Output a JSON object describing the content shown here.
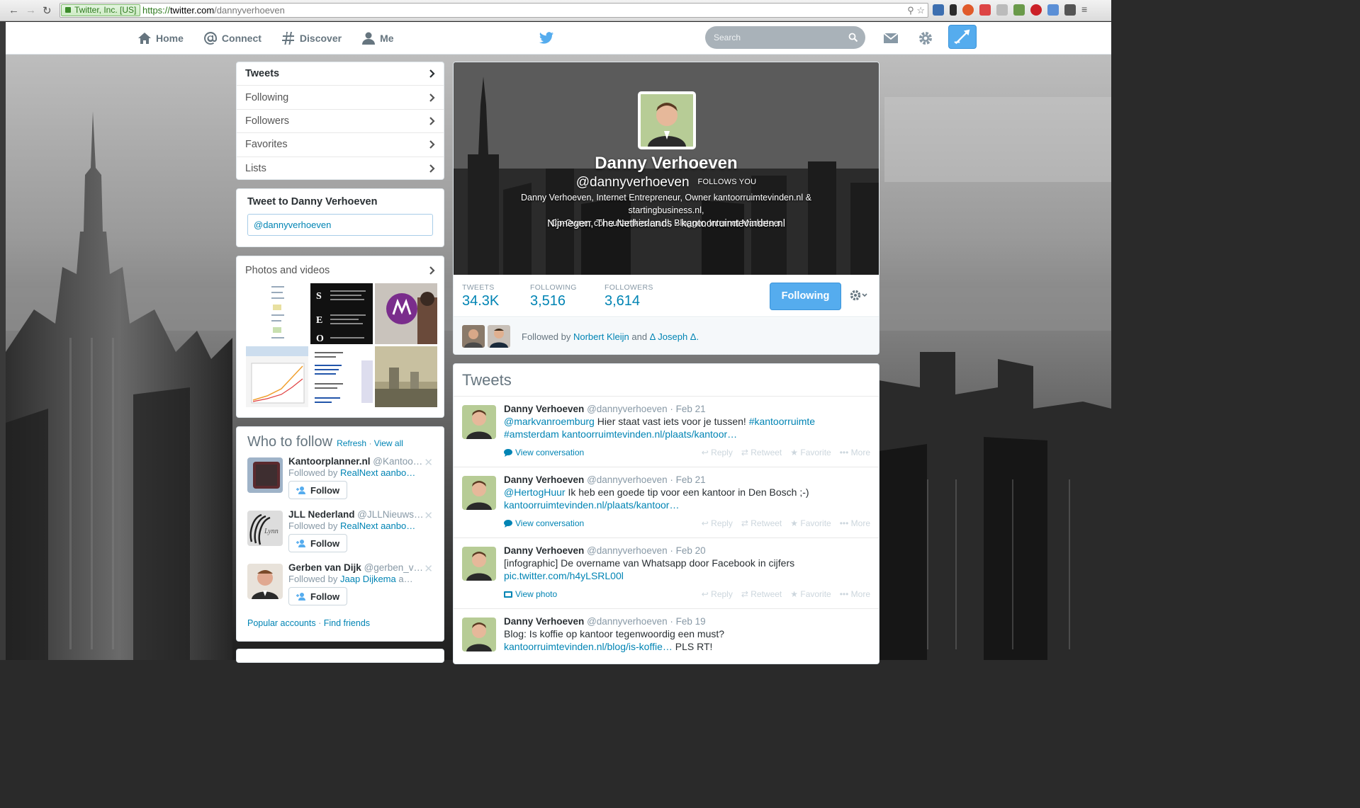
{
  "browser": {
    "ev_cert": "Twitter, Inc. [US]",
    "url_scheme": "https://",
    "url_host": "twitter.com",
    "url_path": "/dannyverhoeven"
  },
  "topbar": {
    "nav": [
      {
        "label": "Home",
        "icon": "home-icon"
      },
      {
        "label": "Connect",
        "icon": "at-icon"
      },
      {
        "label": "Discover",
        "icon": "hash-icon"
      },
      {
        "label": "Me",
        "icon": "person-icon"
      }
    ],
    "search_placeholder": "Search"
  },
  "sidebar_nav": [
    {
      "label": "Tweets"
    },
    {
      "label": "Following"
    },
    {
      "label": "Followers"
    },
    {
      "label": "Favorites"
    },
    {
      "label": "Lists"
    }
  ],
  "tweet_to": {
    "title": "Tweet to Danny Verhoeven",
    "value": "@dannyverhoeven"
  },
  "photos": {
    "title": "Photos and videos"
  },
  "who_to_follow": {
    "title": "Who to follow",
    "refresh": "Refresh",
    "separator": "·",
    "view_all": "View all",
    "follow_label": "Follow",
    "suggestions": [
      {
        "name": "Kantoorplanner.nl",
        "handle": "@Kantoo…",
        "followed_by_prefix": "Followed by ",
        "followed_by_link": "RealNext aanbo…"
      },
      {
        "name": "JLL Nederland",
        "handle": "@JLLNieuws…",
        "followed_by_prefix": "Followed by ",
        "followed_by_link": "RealNext aanbo…"
      },
      {
        "name": "Gerben van Dijk",
        "handle": "@gerben_v…",
        "followed_by_prefix": "Followed by ",
        "followed_by_link": "Jaap Dijkema",
        "followed_by_suffix": " a…"
      }
    ],
    "popular": "Popular accounts",
    "find_friends": "Find friends"
  },
  "profile": {
    "name": "Danny Verhoeven",
    "handle": "@dannyverhoeven",
    "follows_you": "FOLLOWS YOU",
    "bio_line1": "Danny Verhoeven, Internet Entrepreneur, Owner kantoorruimtevinden.nl & startingbusiness.nl,",
    "bio_line2": "Co-Owner consultantkiezen.nl, Blogger, Internet Marketeer",
    "location": "Nijmegen, The Netherlands",
    "loc_sep": "·",
    "website": "kantoorruimtevinden.nl"
  },
  "stats": {
    "tweets_label": "TWEETS",
    "tweets": "34.3K",
    "following_label": "FOLLOWING",
    "following": "3,516",
    "followers_label": "FOLLOWERS",
    "followers": "3,614"
  },
  "following_button": "Following",
  "followed_by": {
    "prefix": "Followed by ",
    "person1": "Norbert Kleijn",
    "and": " and ",
    "person2": "Δ Joseph Δ.",
    "suffix": ""
  },
  "stream": {
    "title": "Tweets",
    "actions": {
      "reply": "Reply",
      "retweet": "Retweet",
      "favorite": "Favorite",
      "more": "More"
    },
    "tweets": [
      {
        "name": "Danny Verhoeven",
        "handle": "@dannyverhoeven",
        "date": " · Feb 21",
        "mention": "@markvanroemburg",
        "text": " Hier staat vast iets voor je tussen! ",
        "hashtag1": "#kantoorruimte",
        "hashtag2": "#amsterdam",
        "link": " kantoorruimtevinden.nl/plaats/kantoor…",
        "footer": "View conversation"
      },
      {
        "name": "Danny Verhoeven",
        "handle": "@dannyverhoeven",
        "date": " · Feb 21",
        "mention": "@HertogHuur",
        "text": " Ik heb een goede tip voor een kantoor in Den Bosch ;-)",
        "link": "kantoorruimtevinden.nl/plaats/kantoor…",
        "footer": "View conversation"
      },
      {
        "name": "Danny Verhoeven",
        "handle": "@dannyverhoeven",
        "date": " · Feb 20",
        "text": "[infographic] De overname van Whatsapp door Facebook in cijfers",
        "link": "pic.twitter.com/h4yLSRL00l",
        "footer": "View photo"
      },
      {
        "name": "Danny Verhoeven",
        "handle": "@dannyverhoeven",
        "date": " · Feb 19",
        "text": "Blog: Is koffie op kantoor tegenwoordig een must?",
        "link": "kantoorruimtevinden.nl/blog/is-koffie…",
        "text_after": " PLS RT!"
      }
    ]
  },
  "colors": {
    "accent": "#55acee",
    "link": "#0084b4",
    "muted": "#8899a6"
  }
}
